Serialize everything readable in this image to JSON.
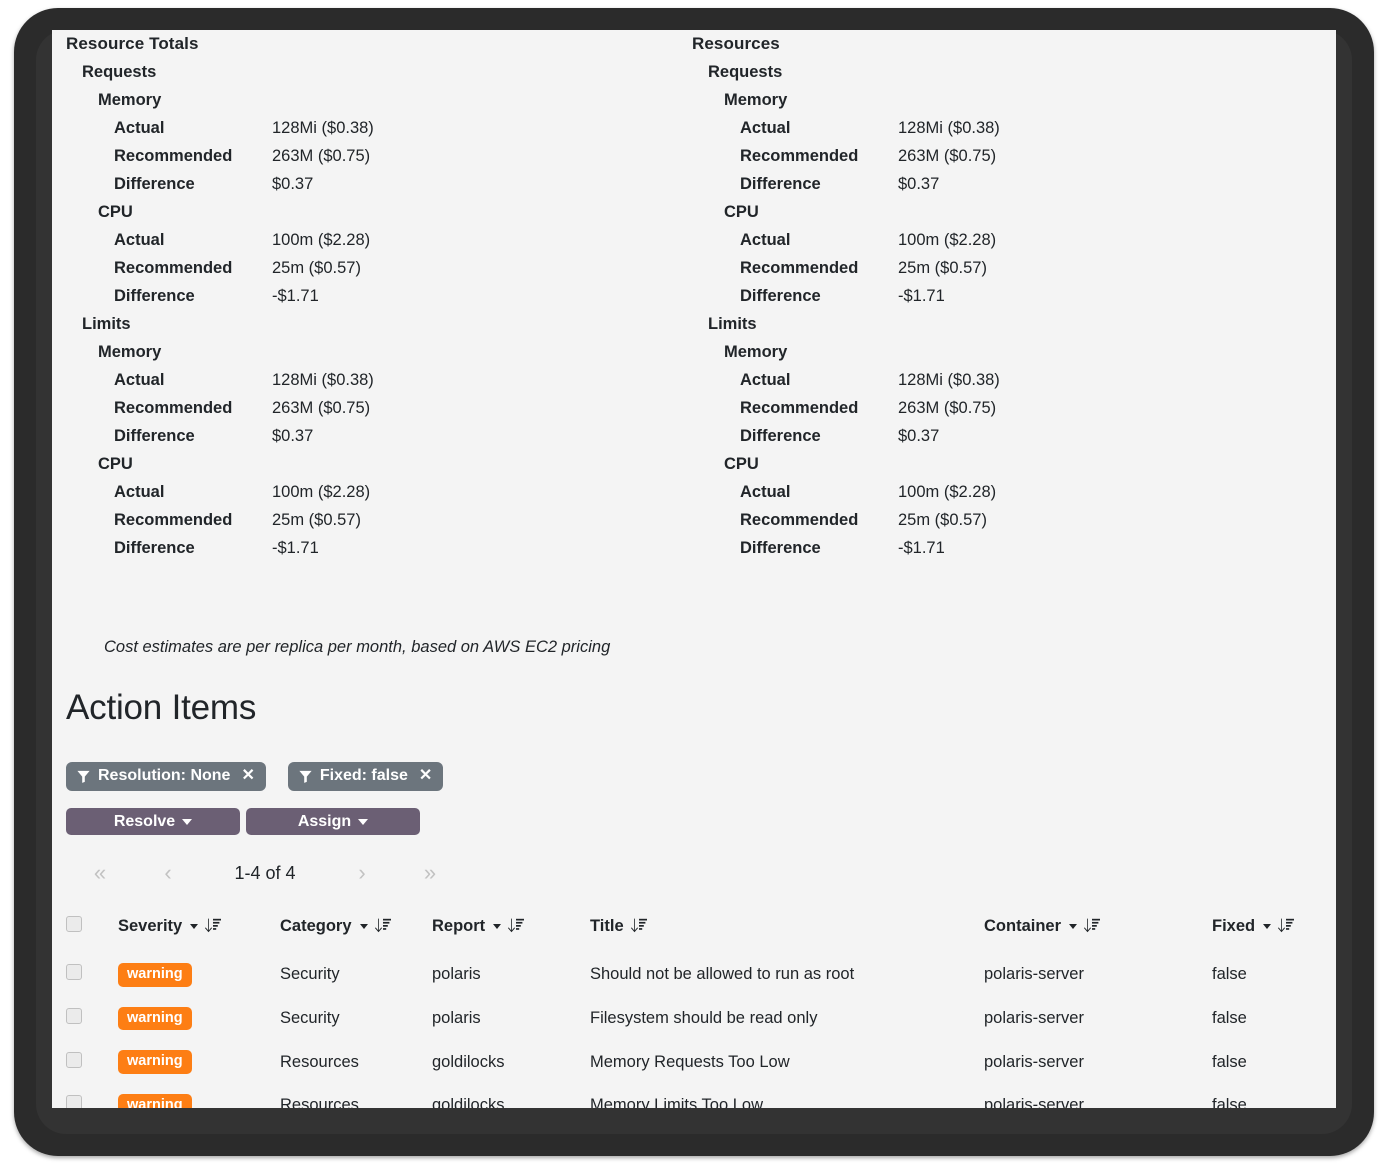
{
  "resource_totals": {
    "left": {
      "title": "Resource Totals",
      "sections": [
        {
          "name": "Requests",
          "groups": [
            {
              "name": "Memory",
              "rows": [
                {
                  "key": "Actual",
                  "value": "128Mi ($0.38)"
                },
                {
                  "key": "Recommended",
                  "value": "263M ($0.75)"
                },
                {
                  "key": "Difference",
                  "value": "$0.37"
                }
              ]
            },
            {
              "name": "CPU",
              "rows": [
                {
                  "key": "Actual",
                  "value": "100m ($2.28)"
                },
                {
                  "key": "Recommended",
                  "value": "25m ($0.57)"
                },
                {
                  "key": "Difference",
                  "value": "-$1.71"
                }
              ]
            }
          ]
        },
        {
          "name": "Limits",
          "groups": [
            {
              "name": "Memory",
              "rows": [
                {
                  "key": "Actual",
                  "value": "128Mi ($0.38)"
                },
                {
                  "key": "Recommended",
                  "value": "263M ($0.75)"
                },
                {
                  "key": "Difference",
                  "value": "$0.37"
                }
              ]
            },
            {
              "name": "CPU",
              "rows": [
                {
                  "key": "Actual",
                  "value": "100m ($2.28)"
                },
                {
                  "key": "Recommended",
                  "value": "25m ($0.57)"
                },
                {
                  "key": "Difference",
                  "value": "-$1.71"
                }
              ]
            }
          ]
        }
      ]
    },
    "right": {
      "title": "Resources",
      "sections": [
        {
          "name": "Requests",
          "groups": [
            {
              "name": "Memory",
              "rows": [
                {
                  "key": "Actual",
                  "value": "128Mi ($0.38)"
                },
                {
                  "key": "Recommended",
                  "value": "263M ($0.75)"
                },
                {
                  "key": "Difference",
                  "value": "$0.37"
                }
              ]
            },
            {
              "name": "CPU",
              "rows": [
                {
                  "key": "Actual",
                  "value": "100m ($2.28)"
                },
                {
                  "key": "Recommended",
                  "value": "25m ($0.57)"
                },
                {
                  "key": "Difference",
                  "value": "-$1.71"
                }
              ]
            }
          ]
        },
        {
          "name": "Limits",
          "groups": [
            {
              "name": "Memory",
              "rows": [
                {
                  "key": "Actual",
                  "value": "128Mi ($0.38)"
                },
                {
                  "key": "Recommended",
                  "value": "263M ($0.75)"
                },
                {
                  "key": "Difference",
                  "value": "$0.37"
                }
              ]
            },
            {
              "name": "CPU",
              "rows": [
                {
                  "key": "Actual",
                  "value": "100m ($2.28)"
                },
                {
                  "key": "Recommended",
                  "value": "25m ($0.57)"
                },
                {
                  "key": "Difference",
                  "value": "-$1.71"
                }
              ]
            }
          ]
        }
      ]
    },
    "cost_note": "Cost estimates are per replica per month, based on AWS EC2 pricing"
  },
  "action_items": {
    "heading": "Action Items",
    "filters": [
      {
        "label": "Resolution: None",
        "icon": "filter-icon",
        "close": "✕"
      },
      {
        "label": "Fixed: false",
        "icon": "filter-icon",
        "close": "✕"
      }
    ],
    "buttons": [
      {
        "label": "Resolve"
      },
      {
        "label": "Assign"
      }
    ],
    "pagination": {
      "first": "«",
      "prev": "‹",
      "summary": "1-4 of 4",
      "next": "›",
      "last": "»"
    },
    "columns": [
      {
        "label": "Severity",
        "has_caret": true,
        "has_sort": true
      },
      {
        "label": "Category",
        "has_caret": true,
        "has_sort": true
      },
      {
        "label": "Report",
        "has_caret": true,
        "has_sort": true
      },
      {
        "label": "Title",
        "has_caret": false,
        "has_sort": true
      },
      {
        "label": "Container",
        "has_caret": true,
        "has_sort": true
      },
      {
        "label": "Fixed",
        "has_caret": true,
        "has_sort": true
      }
    ],
    "rows": [
      {
        "severity": "warning",
        "category": "Security",
        "report": "polaris",
        "title": "Should not be allowed to run as root",
        "container": "polaris-server",
        "fixed": "false"
      },
      {
        "severity": "warning",
        "category": "Security",
        "report": "polaris",
        "title": "Filesystem should be read only",
        "container": "polaris-server",
        "fixed": "false"
      },
      {
        "severity": "warning",
        "category": "Resources",
        "report": "goldilocks",
        "title": "Memory Requests Too Low",
        "container": "polaris-server",
        "fixed": "false"
      },
      {
        "severity": "warning",
        "category": "Resources",
        "report": "goldilocks",
        "title": "Memory Limits Too Low",
        "container": "polaris-server",
        "fixed": "false"
      }
    ]
  },
  "colors": {
    "background": "#f4f4f4",
    "bezel": "#2b2b2b",
    "chip": "#6c757d",
    "button": "#6b5f74",
    "badge_warning": "#fd7e14",
    "text": "#212529",
    "pager_muted": "#c2c2c2"
  }
}
